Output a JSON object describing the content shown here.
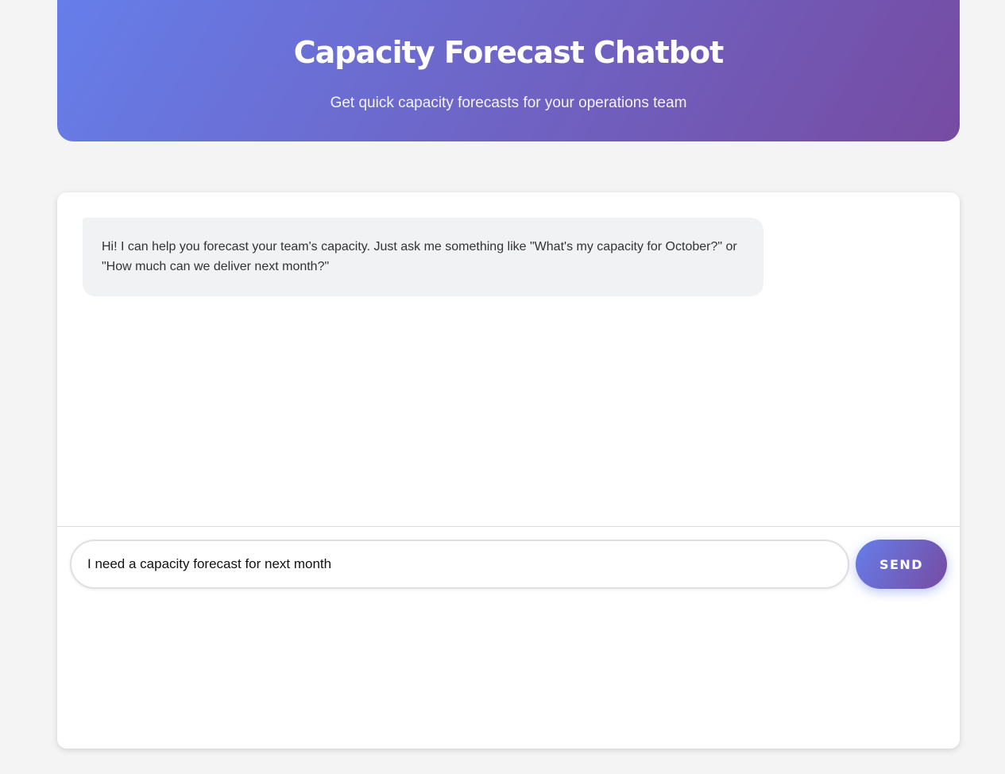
{
  "header": {
    "title": "Capacity Forecast Chatbot",
    "subtitle": "Get quick capacity forecasts for your operations team",
    "gradient_start": "#667eea",
    "gradient_end": "#764ba2"
  },
  "chat": {
    "messages": [
      {
        "sender": "bot",
        "text": "Hi! I can help you forecast your team's capacity. Just ask me something like \"What's my capacity for October?\" or \"How much can we deliver next month?\""
      }
    ]
  },
  "input": {
    "value": "I need a capacity forecast for next month",
    "send_label": "SEND"
  }
}
